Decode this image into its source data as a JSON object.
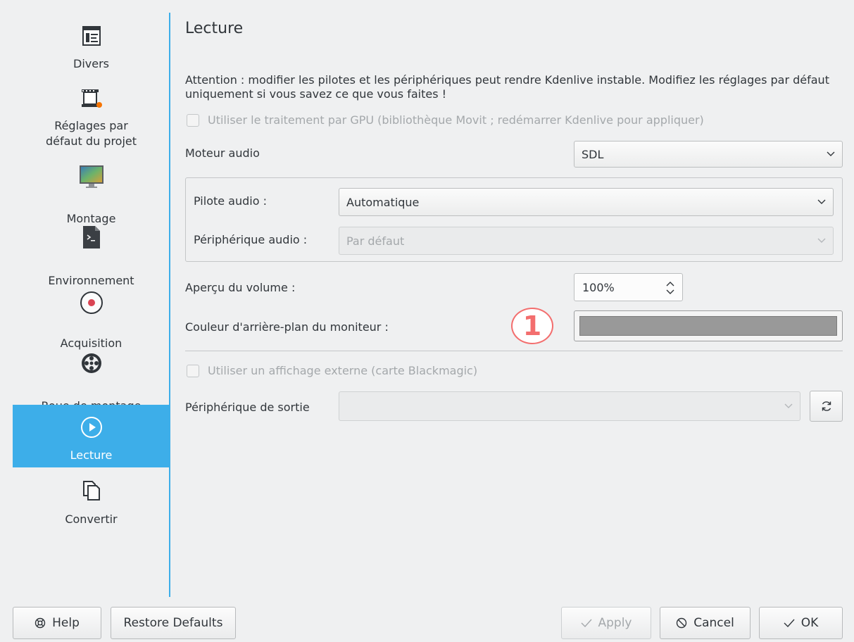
{
  "sidebar": {
    "items": [
      {
        "label": "Divers",
        "icon": "document-list-icon"
      },
      {
        "label": "Réglages par\ndéfaut du projet",
        "icon": "film-icon"
      },
      {
        "label": "Montage",
        "icon": "monitor-icon"
      },
      {
        "label": "Environnement",
        "icon": "terminal-icon"
      },
      {
        "label": "Acquisition",
        "icon": "record-icon"
      },
      {
        "label": "Roue de montage",
        "icon": "wheel-icon"
      },
      {
        "label": "Lecture",
        "icon": "play-icon"
      },
      {
        "label": "Convertir",
        "icon": "copy-icon"
      }
    ],
    "active_index": 6
  },
  "page": {
    "title": "Lecture",
    "warning": "Attention : modifier les pilotes et les périphériques peut rendre Kdenlive instable. Modifiez les réglages par défaut uniquement si vous savez ce que vous faites !",
    "gpu_checkbox": "Utiliser le traitement par GPU (bibliothèque Movit ; redémarrer Kdenlive pour appliquer)",
    "audio_engine_label": "Moteur audio",
    "audio_engine_value": "SDL",
    "audio_driver_label": "Pilote audio :",
    "audio_driver_value": "Automatique",
    "audio_device_label": "Périphérique audio :",
    "audio_device_value": "Par défaut",
    "volume_label": "Aperçu du volume :",
    "volume_value": "100%",
    "monitor_bg_label": "Couleur d'arrière-plan du moniteur :",
    "monitor_bg_color": "#999999",
    "annotation_number": "1",
    "external_checkbox": "Utiliser un affichage externe (carte Blackmagic)",
    "output_device_label": "Périphérique de sortie",
    "output_device_value": ""
  },
  "buttons": {
    "help": "Help",
    "restore": "Restore Defaults",
    "apply": "Apply",
    "cancel": "Cancel",
    "ok": "OK"
  },
  "colors": {
    "accent": "#3daee9",
    "annotation": "#f36e6e"
  }
}
